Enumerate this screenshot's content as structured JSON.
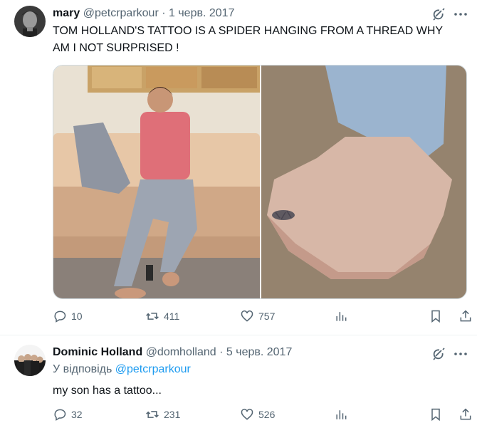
{
  "tweet1": {
    "display_name": "mary",
    "handle": "@petcrparkour",
    "separator": "·",
    "date": "1 черв. 2017",
    "text": "TOM HOLLAND'S TATTOO IS A SPIDER HANGING FROM A THREAD WHY AM I NOT SURPRISED !",
    "replies": "10",
    "retweets": "411",
    "likes": "757"
  },
  "tweet2": {
    "display_name": "Dominic Holland",
    "handle": "@domholland",
    "separator": "·",
    "date": "5 черв. 2017",
    "reply_prefix": "У відповідь",
    "reply_to": "@petcrparkour",
    "text": "my son has a tattoo...",
    "replies": "32",
    "retweets": "231",
    "likes": "526"
  },
  "icons": {
    "grok": "grok-icon",
    "more": "more-icon",
    "reply": "reply-icon",
    "retweet": "retweet-icon",
    "like": "heart-icon",
    "views": "views-icon",
    "bookmark": "bookmark-icon",
    "share": "share-icon"
  },
  "colors": {
    "text": "#0f1419",
    "secondary": "#536471",
    "mention": "#1d9bf0",
    "divider": "#eff3f4"
  }
}
